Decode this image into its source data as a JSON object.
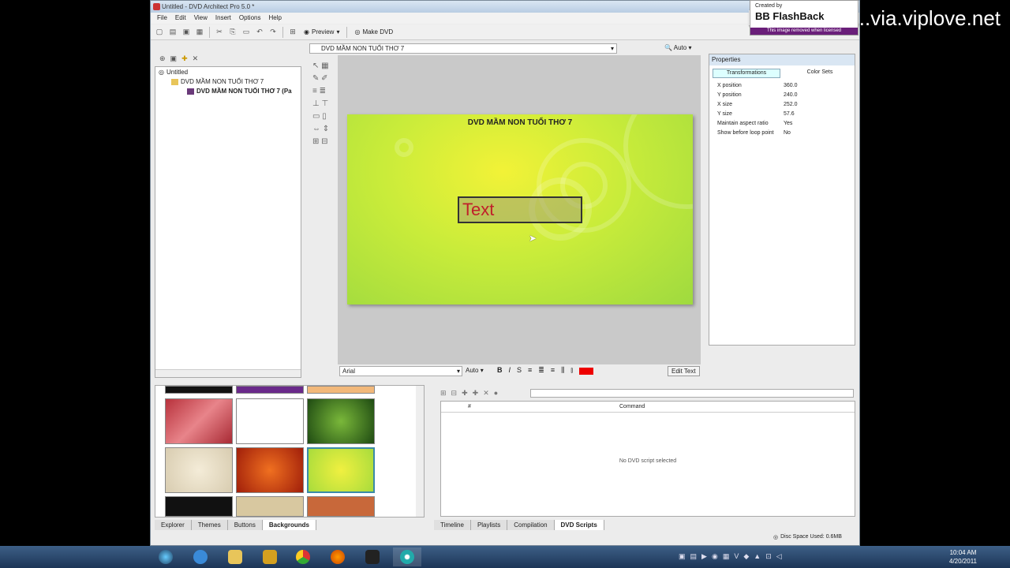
{
  "window": {
    "title": "Untitled - DVD Architect Pro 5.0 *"
  },
  "menu": [
    "File",
    "Edit",
    "View",
    "Insert",
    "Options",
    "Help"
  ],
  "toolbar": {
    "preview": "Preview",
    "make_dvd": "Make DVD"
  },
  "explorer": {
    "root": "Untitled",
    "child": "DVD MẦM NON TUỔI THƠ 7",
    "leaf": "DVD MẦM NON TUỔI THƠ 7 (Pa"
  },
  "editor": {
    "selector": "DVD MẦM NON TUỔI THƠ 7",
    "zoom": "Auto",
    "menu_title": "DVD MẦM NON TUỔI THƠ 7",
    "textbox": "Text"
  },
  "text_toolbar": {
    "font": "Arial",
    "size": "Auto",
    "edit_text": "Edit Text"
  },
  "properties": {
    "header": "Properties",
    "tab1": "Transformations",
    "tab2": "Color Sets",
    "rows": [
      [
        "X position",
        "360.0"
      ],
      [
        "Y position",
        "240.0"
      ],
      [
        "X size",
        "252.0"
      ],
      [
        "Y size",
        "57.6"
      ],
      [
        "Maintain aspect ratio",
        "Yes"
      ],
      [
        "Show before loop point",
        "No"
      ]
    ]
  },
  "bottom_tabs": [
    "Explorer",
    "Themes",
    "Buttons",
    "Backgrounds"
  ],
  "scripts": {
    "col_num": "#",
    "col_command": "Command",
    "empty": "No DVD script selected"
  },
  "bottom_tabs_right": [
    "Timeline",
    "Playlists",
    "Compilation",
    "DVD Scripts"
  ],
  "status": {
    "disc": "Disc Space Used: 0.6MB"
  },
  "clock": {
    "time": "10:04 AM",
    "date": "4/20/2011"
  },
  "watermark": {
    "url": "http://www.....via.viplove.net",
    "created": "Created by",
    "brand": "BB FlashBack",
    "notice": "This image removed when licensed"
  },
  "colors": {
    "accent": "#c0202a",
    "bg_green": "#c9ec3a"
  }
}
